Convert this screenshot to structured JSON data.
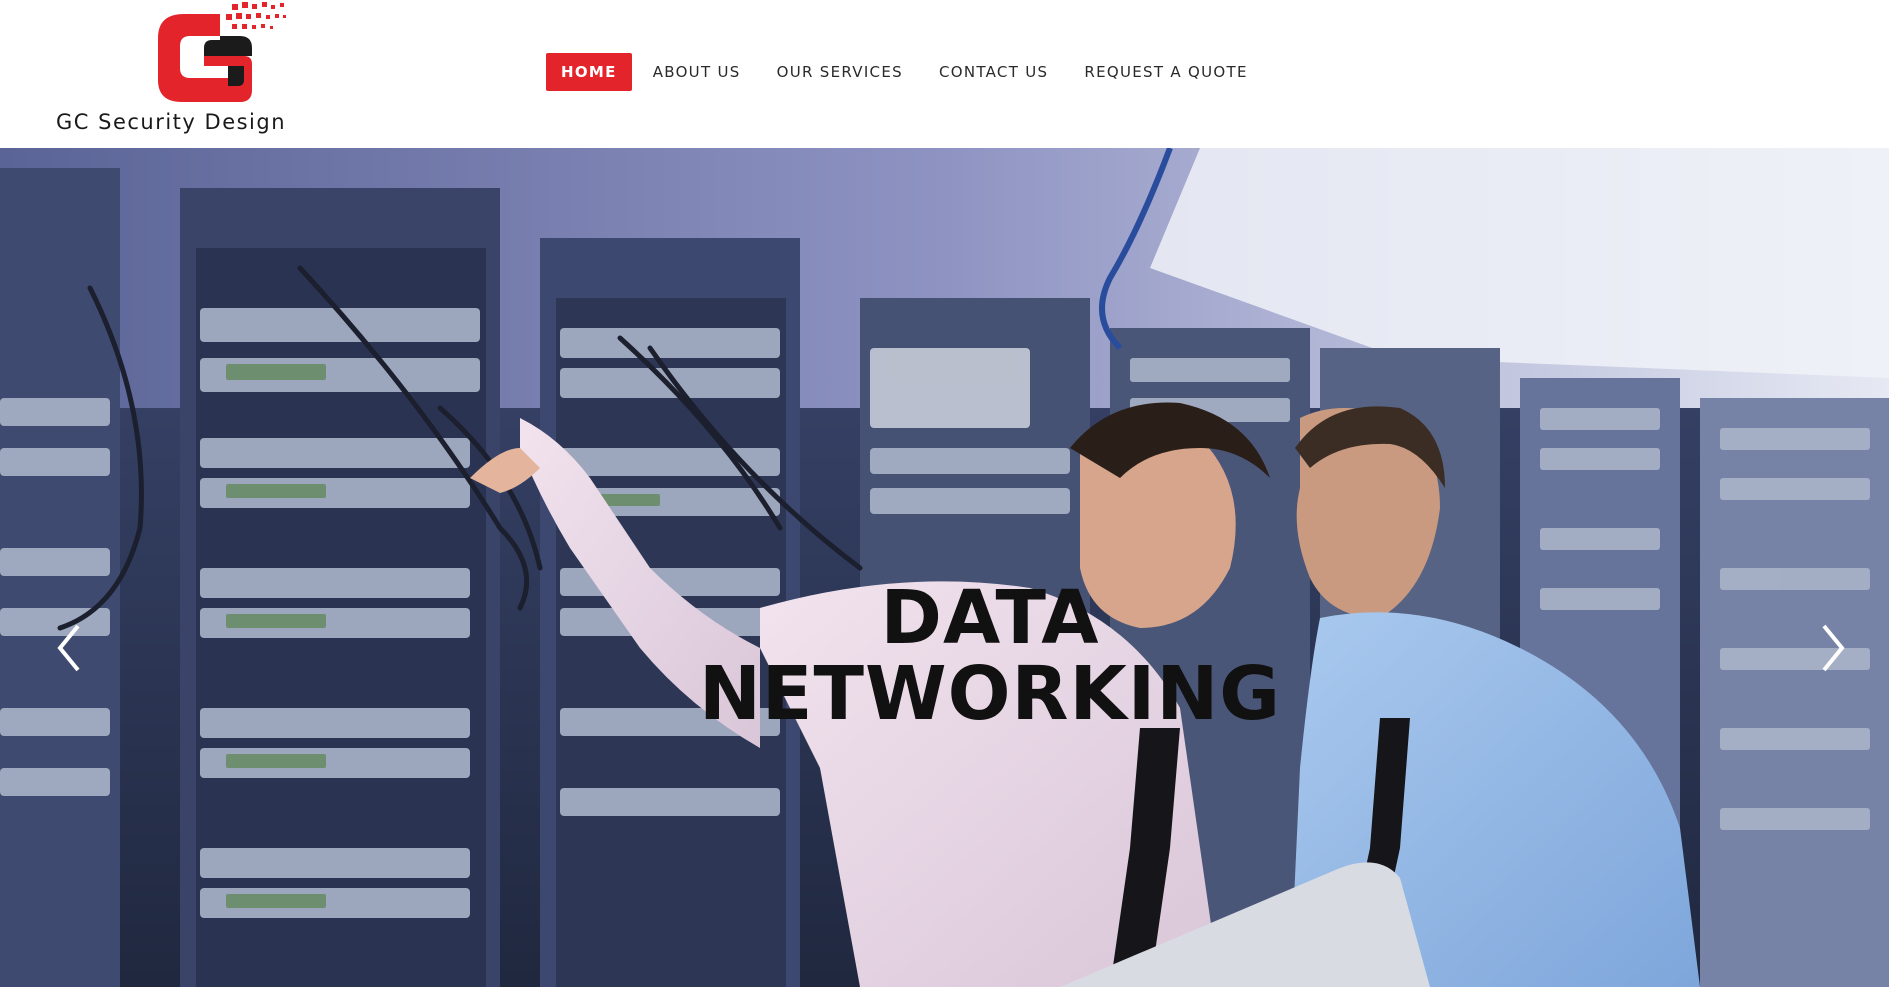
{
  "brand": {
    "name": "GC Security Design",
    "accent": "#e3242b"
  },
  "nav": {
    "items": [
      {
        "label": "HOME",
        "active": true
      },
      {
        "label": "ABOUT US",
        "active": false
      },
      {
        "label": "OUR SERVICES",
        "active": false
      },
      {
        "label": "CONTACT US",
        "active": false
      },
      {
        "label": "REQUEST A QUOTE",
        "active": false
      }
    ]
  },
  "hero": {
    "title_line1": "DATA",
    "title_line2": "NETWORKING",
    "prev_icon": "chevron-left-icon",
    "next_icon": "chevron-right-icon"
  }
}
